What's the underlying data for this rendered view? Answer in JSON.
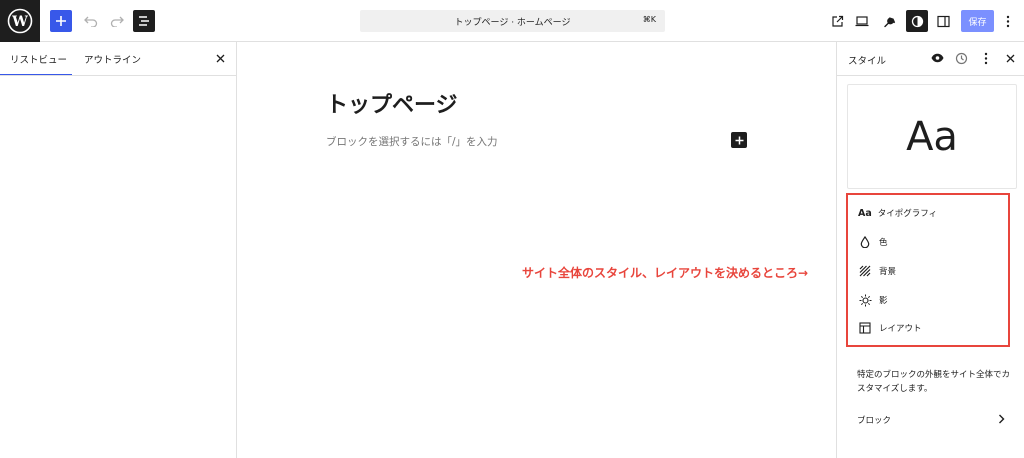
{
  "topbar": {
    "document_title": "トップページ · ホームページ",
    "shortcut": "⌘K",
    "save_label": "保存"
  },
  "left_panel": {
    "tabs": [
      {
        "label": "リストビュー",
        "active": true
      },
      {
        "label": "アウトライン",
        "active": false
      }
    ]
  },
  "editor": {
    "page_title": "トップページ",
    "placeholder": "ブロックを選択するには「/」を入力"
  },
  "annotation": "サイト全体のスタイル、レイアウトを決めるところ→",
  "styles_panel": {
    "title": "スタイル",
    "preview_text": "Aa",
    "nav_items": [
      {
        "icon": "typography-icon",
        "label": "タイポグラフィ"
      },
      {
        "icon": "color-drop-icon",
        "label": "色"
      },
      {
        "icon": "background-icon",
        "label": "背景"
      },
      {
        "icon": "shadow-icon",
        "label": "影"
      },
      {
        "icon": "layout-icon",
        "label": "レイアウト"
      }
    ],
    "description": "特定のブロックの外観をサイト全体でカスタマイズします。",
    "blocks_label": "ブロック"
  },
  "colors": {
    "accent": "#3858e9",
    "save_button": "#7b90ff",
    "annotation": "#e8453c",
    "dark": "#1e1e1e"
  }
}
